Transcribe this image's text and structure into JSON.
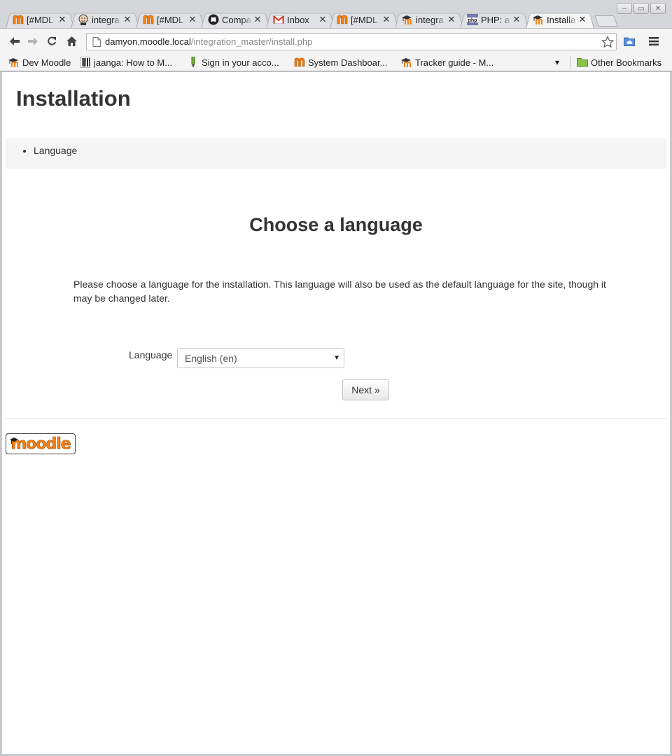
{
  "browser": {
    "tabs": [
      {
        "title": "[#MDL",
        "icon": "moodle-m-icon",
        "active": false
      },
      {
        "title": "integra",
        "icon": "jenkins-icon",
        "active": false
      },
      {
        "title": "[#MDL",
        "icon": "moodle-m-icon",
        "active": false
      },
      {
        "title": "Compa",
        "icon": "github-icon",
        "active": false
      },
      {
        "title": "Inbox",
        "icon": "gmail-icon",
        "active": false
      },
      {
        "title": "[#MDL",
        "icon": "moodle-m-icon",
        "active": false
      },
      {
        "title": "integra",
        "icon": "moodle-hat-icon",
        "active": false
      },
      {
        "title": "PHP: a",
        "icon": "php-icon",
        "active": false
      },
      {
        "title": "Installa",
        "icon": "moodle-hat-icon",
        "active": true
      }
    ],
    "address": {
      "host": "damyon.moodle.local",
      "path": "/integration_master/install.php"
    },
    "bookmarks": [
      {
        "label": "Dev Moodle",
        "icon": "moodle-hat-icon"
      },
      {
        "label": "jaanga: How to M...",
        "icon": "barcode-icon"
      },
      {
        "label": "Sign in your acco...",
        "icon": "pen-icon"
      },
      {
        "label": "System Dashboar...",
        "icon": "moodle-m-icon"
      },
      {
        "label": "Tracker guide - M...",
        "icon": "moodle-hat-icon"
      }
    ],
    "other_bookmarks": "Other Bookmarks",
    "overflow_chevron": "▾"
  },
  "page": {
    "title": "Installation",
    "steps": [
      "Language"
    ],
    "section_title": "Choose a language",
    "intro": "Please choose a language for the installation. This language will also be used as the default language for the site, though it may be changed later.",
    "language_label": "Language",
    "language_value": "English (en)",
    "next_label": "Next »",
    "logo_text": "moodle"
  },
  "colors": {
    "moodle_orange": "#f98012",
    "tab_active": "#f4f4f4"
  }
}
